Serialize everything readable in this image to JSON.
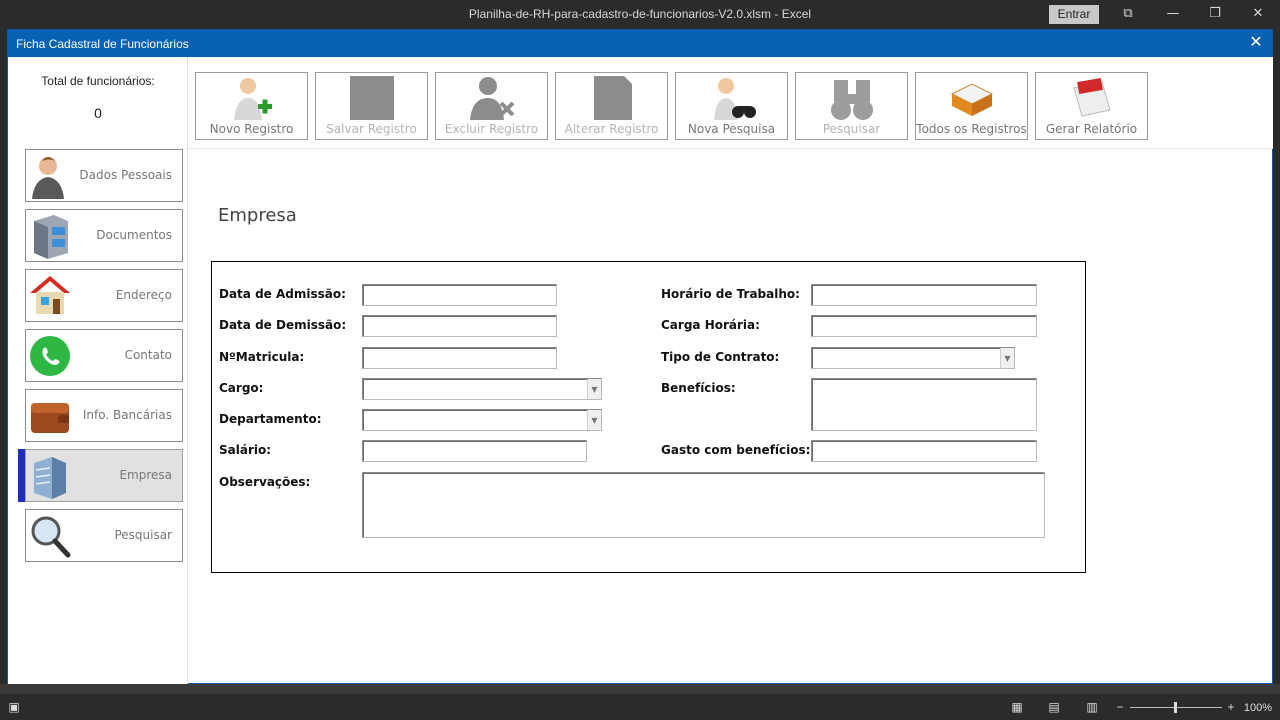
{
  "window": {
    "title": "Planilha-de-RH-para-cadastro-de-funcionarios-V2.0.xlsm  -  Excel",
    "signin_label": "Entrar",
    "controls": {
      "ribbon": "⧉",
      "minimize": "—",
      "restore": "❐",
      "close": "✕"
    }
  },
  "form": {
    "title": "Ficha Cadastral de Funcionários",
    "close": "✕",
    "total_label": "Total de funcionários:",
    "total_value": "0",
    "section_title": "Empresa"
  },
  "nav": [
    {
      "label": "Dados Pessoais",
      "icon": "person-icon"
    },
    {
      "label": "Documentos",
      "icon": "file-cabinet-icon"
    },
    {
      "label": "Endereço",
      "icon": "house-icon"
    },
    {
      "label": "Contato",
      "icon": "whatsapp-icon"
    },
    {
      "label": "Info. Bancárias",
      "icon": "wallet-icon"
    },
    {
      "label": "Empresa",
      "icon": "building-icon",
      "active": true
    },
    {
      "label": "Pesquisar",
      "icon": "magnifier-icon"
    }
  ],
  "toolbar": [
    {
      "label": "Novo Registro",
      "icon": "add-person-icon",
      "enabled": true
    },
    {
      "label": "Salvar Registro",
      "icon": "save-icon",
      "enabled": false
    },
    {
      "label": "Excluir Registro",
      "icon": "delete-person-icon",
      "enabled": false
    },
    {
      "label": "Alterar Registro",
      "icon": "edit-icon",
      "enabled": false
    },
    {
      "label": "Nova Pesquisa",
      "icon": "person-binoculars-icon",
      "enabled": true
    },
    {
      "label": "Pesquisar",
      "icon": "binoculars-icon",
      "enabled": false
    },
    {
      "label": "Todos os Registros",
      "icon": "inbox-tray-icon",
      "enabled": true
    },
    {
      "label": "Gerar Relatório",
      "icon": "pdf-icon",
      "enabled": true
    }
  ],
  "fields": {
    "admissao": {
      "label": "Data de Admissão:",
      "value": ""
    },
    "demissao": {
      "label": "Data de Demissão:",
      "value": ""
    },
    "matricula": {
      "label": "NºMatricula:",
      "value": ""
    },
    "cargo": {
      "label": "Cargo:",
      "value": ""
    },
    "departamento": {
      "label": "Departamento:",
      "value": ""
    },
    "salario": {
      "label": "Salário:",
      "value": ""
    },
    "observacoes": {
      "label": "Observações:",
      "value": ""
    },
    "horario": {
      "label": "Horário de Trabalho:",
      "value": ""
    },
    "carga": {
      "label": "Carga Horária:",
      "value": ""
    },
    "contrato": {
      "label": "Tipo de Contrato:",
      "value": ""
    },
    "beneficios": {
      "label": "Benefícios:",
      "value": ""
    },
    "gasto": {
      "label": "Gasto com benefícios:",
      "value": ""
    }
  },
  "statusbar": {
    "zoom": "100%",
    "zoom_minus": "−",
    "zoom_plus": "+"
  },
  "colors": {
    "form_titlebar": "#0862b4",
    "nav_accent": "#1d2dbd",
    "active_nav_bg": "#e1e1e1"
  }
}
